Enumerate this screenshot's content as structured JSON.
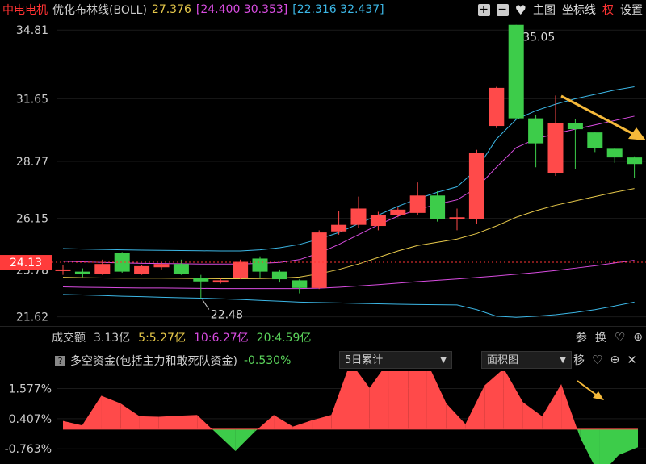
{
  "header": {
    "stock_name": "中电电机",
    "indicator_name": "优化布林线(BOLL)",
    "mid_value": "27.376",
    "band1": "[24.400 30.353]",
    "band2": "[22.316 32.437]",
    "buttons": {
      "main": "主图",
      "indicator": "坐标线",
      "right": "权",
      "settings": "设置"
    },
    "colors": {
      "stock": "#ff3333",
      "mid": "#e6c84a",
      "band1": "#d84ce0",
      "band2": "#3cb7e6"
    }
  },
  "price_axis": {
    "labels": [
      "34.81",
      "31.65",
      "28.77",
      "26.15",
      "23.78",
      "21.62"
    ],
    "current_price": "24.13"
  },
  "annotations": {
    "high": "35.05",
    "low": "22.48"
  },
  "volume": {
    "label": "成交额",
    "total": "3.13亿",
    "ma5": "5:5.27亿",
    "ma10": "10:6.27亿",
    "ma20": "20:4.59亿",
    "buttons": {
      "b1": "参",
      "b2": "换"
    }
  },
  "indicator": {
    "name": "多空资金(包括主力和敢死队资金)",
    "value": "-0.530%",
    "period": "5日累计",
    "style": "面积图",
    "move": "移",
    "axis_labels": [
      "1.577%",
      "0.407%",
      "-0.763%"
    ]
  },
  "chart_data": {
    "type": "candlestick",
    "ylim": [
      21.2,
      35.3
    ],
    "candles": [
      {
        "o": 23.8,
        "c": 23.8,
        "h": 24.0,
        "l": 23.55
      },
      {
        "o": 23.7,
        "c": 23.6,
        "h": 23.85,
        "l": 23.45
      },
      {
        "o": 23.6,
        "c": 24.05,
        "h": 24.25,
        "l": 23.55
      },
      {
        "o": 24.55,
        "c": 23.7,
        "h": 24.6,
        "l": 23.65
      },
      {
        "o": 23.6,
        "c": 23.95,
        "h": 24.0,
        "l": 23.55
      },
      {
        "o": 23.9,
        "c": 24.05,
        "h": 24.15,
        "l": 23.8
      },
      {
        "o": 24.05,
        "c": 23.6,
        "h": 24.25,
        "l": 23.55
      },
      {
        "o": 23.4,
        "c": 23.25,
        "h": 23.55,
        "l": 22.48
      },
      {
        "o": 23.2,
        "c": 23.3,
        "h": 23.4,
        "l": 23.15
      },
      {
        "o": 23.4,
        "c": 24.15,
        "h": 24.25,
        "l": 23.35
      },
      {
        "o": 24.3,
        "c": 23.7,
        "h": 24.4,
        "l": 23.4
      },
      {
        "o": 23.7,
        "c": 23.35,
        "h": 23.8,
        "l": 23.2
      },
      {
        "o": 23.3,
        "c": 22.95,
        "h": 23.35,
        "l": 22.7
      },
      {
        "o": 22.95,
        "c": 25.5,
        "h": 25.6,
        "l": 22.9
      },
      {
        "o": 25.55,
        "c": 25.85,
        "h": 26.5,
        "l": 25.4
      },
      {
        "o": 25.85,
        "c": 26.6,
        "h": 27.15,
        "l": 25.7
      },
      {
        "o": 25.8,
        "c": 26.3,
        "h": 26.45,
        "l": 25.6
      },
      {
        "o": 26.3,
        "c": 26.55,
        "h": 26.65,
        "l": 26.2
      },
      {
        "o": 26.4,
        "c": 27.2,
        "h": 27.8,
        "l": 26.3
      },
      {
        "o": 27.2,
        "c": 26.1,
        "h": 27.4,
        "l": 26.0
      },
      {
        "o": 26.1,
        "c": 26.2,
        "h": 26.6,
        "l": 25.6
      },
      {
        "o": 26.1,
        "c": 29.15,
        "h": 29.3,
        "l": 25.9
      },
      {
        "o": 30.4,
        "c": 32.15,
        "h": 32.2,
        "l": 30.3
      },
      {
        "o": 35.05,
        "c": 30.75,
        "h": 35.05,
        "l": 30.7
      },
      {
        "o": 30.75,
        "c": 29.6,
        "h": 30.9,
        "l": 28.5
      },
      {
        "o": 28.25,
        "c": 30.55,
        "h": 31.8,
        "l": 28.1
      },
      {
        "o": 30.55,
        "c": 30.25,
        "h": 30.7,
        "l": 28.4
      },
      {
        "o": 30.1,
        "c": 29.4,
        "h": 30.1,
        "l": 29.2
      },
      {
        "o": 29.35,
        "c": 28.95,
        "h": 29.4,
        "l": 28.7
      },
      {
        "o": 28.95,
        "c": 28.65,
        "h": 29.0,
        "l": 28.0
      }
    ],
    "mid": [
      23.44,
      23.42,
      23.41,
      23.4,
      23.4,
      23.4,
      23.39,
      23.38,
      23.37,
      23.37,
      23.38,
      23.4,
      23.45,
      23.6,
      23.8,
      24.05,
      24.35,
      24.65,
      24.9,
      25.05,
      25.2,
      25.45,
      25.8,
      26.2,
      26.5,
      26.75,
      26.95,
      27.15,
      27.35,
      27.52
    ],
    "upper1": [
      24.18,
      24.15,
      24.12,
      24.1,
      24.08,
      24.07,
      24.06,
      24.05,
      24.05,
      24.05,
      24.08,
      24.12,
      24.25,
      24.55,
      24.95,
      25.4,
      25.85,
      26.25,
      26.55,
      26.8,
      27.0,
      27.55,
      28.5,
      29.4,
      29.8,
      30.05,
      30.25,
      30.45,
      30.65,
      30.85
    ],
    "lower1": [
      23.0,
      22.98,
      22.97,
      22.96,
      22.95,
      22.95,
      22.94,
      22.93,
      22.92,
      22.92,
      22.92,
      22.92,
      22.92,
      22.94,
      22.98,
      23.04,
      23.1,
      23.17,
      23.24,
      23.3,
      23.36,
      23.43,
      23.5,
      23.58,
      23.66,
      23.75,
      23.86,
      23.97,
      24.1,
      24.22
    ],
    "upper2": [
      24.76,
      24.74,
      24.72,
      24.7,
      24.69,
      24.68,
      24.67,
      24.66,
      24.65,
      24.65,
      24.7,
      24.8,
      24.95,
      25.2,
      25.5,
      25.9,
      26.3,
      26.7,
      27.05,
      27.35,
      27.6,
      28.4,
      29.8,
      30.7,
      31.1,
      31.4,
      31.65,
      31.85,
      32.05,
      32.2
    ],
    "lower2": [
      22.65,
      22.63,
      22.6,
      22.57,
      22.55,
      22.52,
      22.5,
      22.48,
      22.45,
      22.42,
      22.38,
      22.34,
      22.3,
      22.28,
      22.26,
      22.24,
      22.22,
      22.2,
      22.19,
      22.18,
      22.17,
      21.95,
      21.65,
      21.6,
      21.65,
      21.72,
      21.82,
      21.95,
      22.12,
      22.3
    ]
  },
  "indicator_data": {
    "type": "area",
    "ylim": [
      -1.35,
      2.25
    ],
    "values": [
      0.32,
      0.15,
      1.3,
      1.0,
      0.5,
      0.48,
      0.52,
      0.55,
      -0.15,
      -0.85,
      -0.1,
      0.55,
      0.1,
      0.35,
      0.55,
      2.6,
      1.6,
      2.65,
      2.4,
      2.6,
      1.0,
      0.2,
      1.7,
      2.35,
      1.05,
      0.5,
      1.75,
      -0.35,
      -1.8,
      -1.0,
      -0.7
    ]
  }
}
